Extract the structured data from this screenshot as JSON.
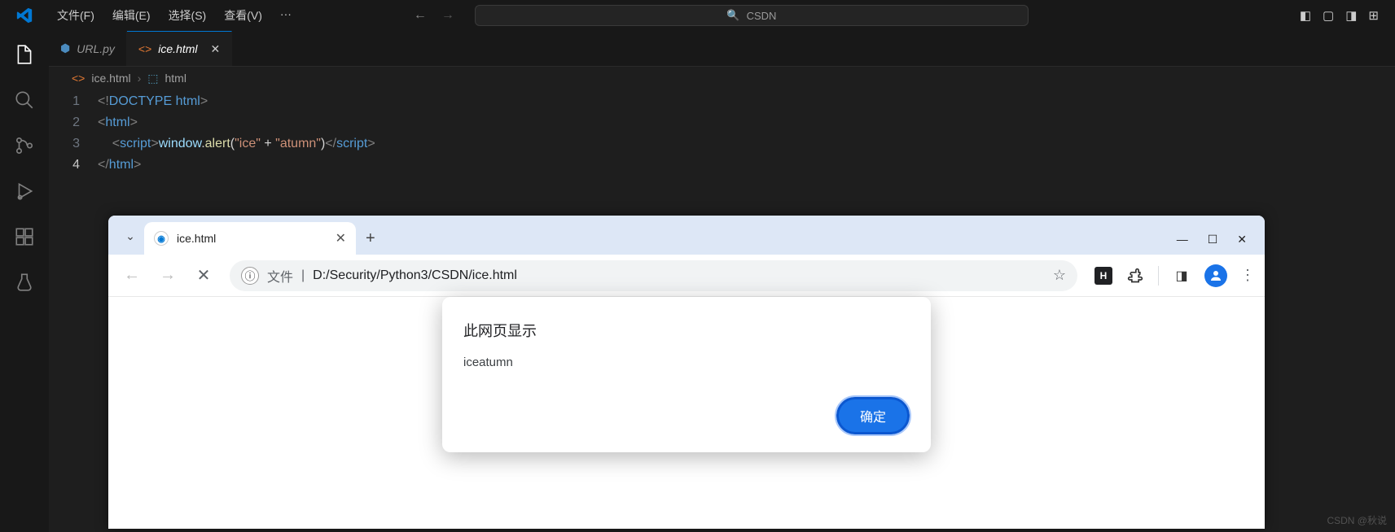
{
  "vscode": {
    "menu": {
      "file": "文件(F)",
      "edit": "编辑(E)",
      "select": "选择(S)",
      "view": "查看(V)",
      "more": "···"
    },
    "search_placeholder": "CSDN",
    "tabs": [
      {
        "label": "URL.py",
        "icon": "🐍",
        "active": false
      },
      {
        "label": "ice.html",
        "icon": "<>",
        "active": true
      }
    ],
    "breadcrumb": {
      "file": "ice.html",
      "element": "html"
    },
    "code": {
      "lines": [
        1,
        2,
        3,
        4
      ],
      "doctype": "DOCTYPE",
      "html_kw": "html",
      "script_tag": "script",
      "window_obj": "window",
      "alert_fn": "alert",
      "str1": "\"ice\"",
      "plus": " + ",
      "str2": "\"atumn\""
    }
  },
  "browser": {
    "tab_title": "ice.html",
    "address": {
      "file_label": "文件",
      "path": "D:/Security/Python3/CSDN/ice.html"
    },
    "alert": {
      "title": "此网页显示",
      "message": "iceatumn",
      "ok": "确定"
    },
    "ext_badge": "H"
  },
  "watermark": "CSDN @秋说"
}
